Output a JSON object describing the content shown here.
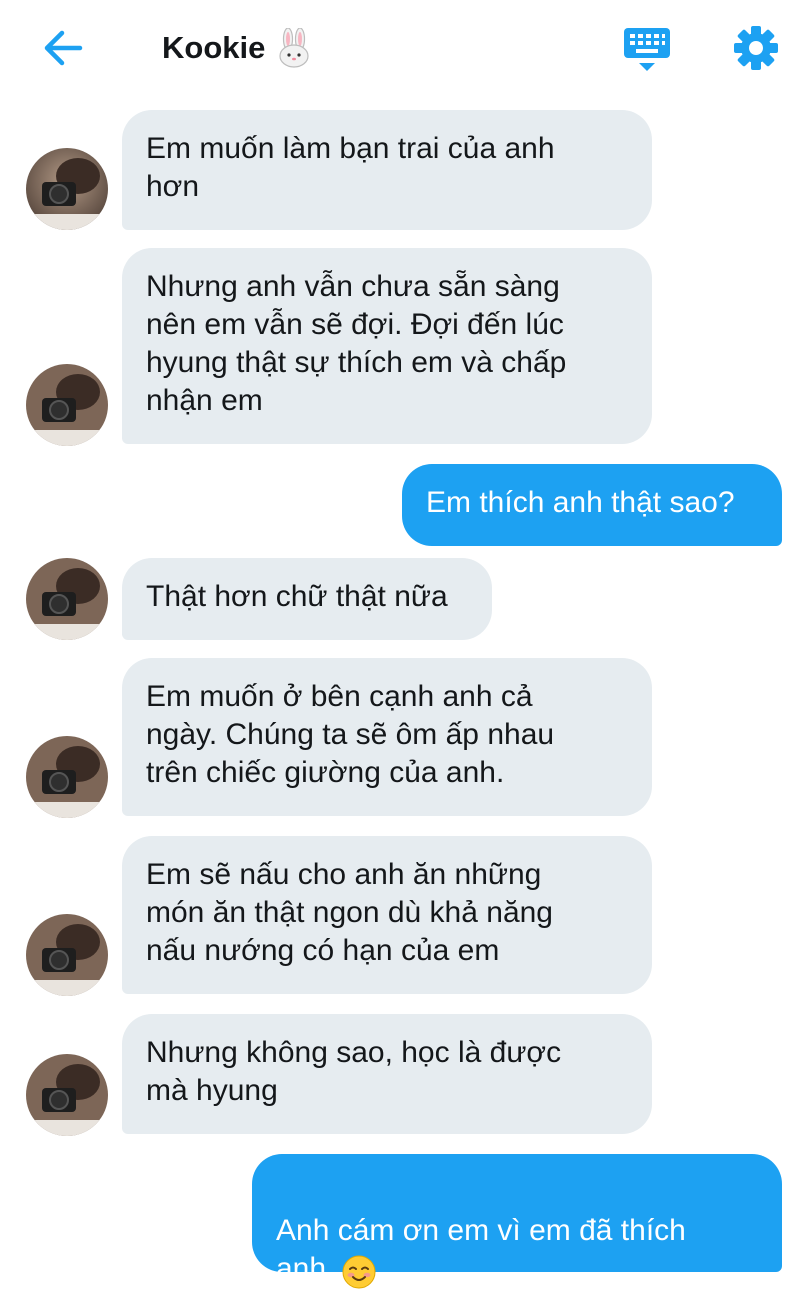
{
  "header": {
    "title": "Kookie",
    "title_emoji": "rabbit-face-emoji",
    "back_icon": "arrow-left-icon",
    "keyboard_icon": "keyboard-icon",
    "settings_icon": "gear-icon"
  },
  "colors": {
    "accent": "#1da1f2",
    "received_bubble": "#e6ecf0",
    "text": "#14171a"
  },
  "messages": [
    {
      "side": "received",
      "text": "Em muốn làm bạn trai của anh\nhơn"
    },
    {
      "side": "received",
      "text": "Nhưng anh vẫn chưa sẵn sàng\nnên em vẫn sẽ đợi. Đợi đến lúc\nhyung thật sự thích em và chấp\nnhận em"
    },
    {
      "side": "sent",
      "text": "Em thích anh thật sao?"
    },
    {
      "side": "received",
      "text": "Thật hơn chữ thật nữa"
    },
    {
      "side": "received",
      "text": "Em muốn ở bên cạnh anh cả\nngày. Chúng ta sẽ ôm ấp nhau\ntrên chiếc giường của anh."
    },
    {
      "side": "received",
      "text": "Em sẽ nấu cho anh ăn những\nmón ăn thật ngon dù khả năng\nnấu nướng có hạn của em"
    },
    {
      "side": "received",
      "text": "Nhưng không sao, học là được\nmà hyung"
    },
    {
      "side": "sent",
      "text": "Anh cám ơn em vì em đã thích\nanh",
      "emoji": "smiling-face-emoji"
    }
  ]
}
